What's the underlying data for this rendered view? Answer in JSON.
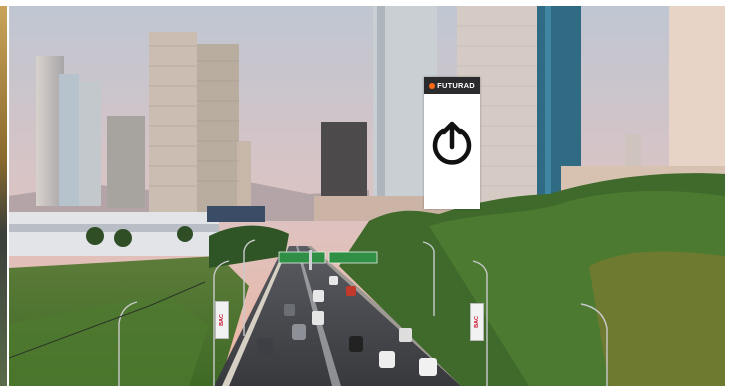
{
  "image": {
    "billboard": {
      "brand_label": "FUTURAD",
      "icon": "upload-power-icon",
      "brand_color": "#ff6a13"
    },
    "signs": {
      "bac_left": "BAC",
      "bac_right": "BAC"
    },
    "colors": {
      "sky_top": "#c9cdd6",
      "sky_bottom": "#e9b3a3",
      "grass": "#4a7a2e",
      "road": "#3f4044"
    }
  }
}
